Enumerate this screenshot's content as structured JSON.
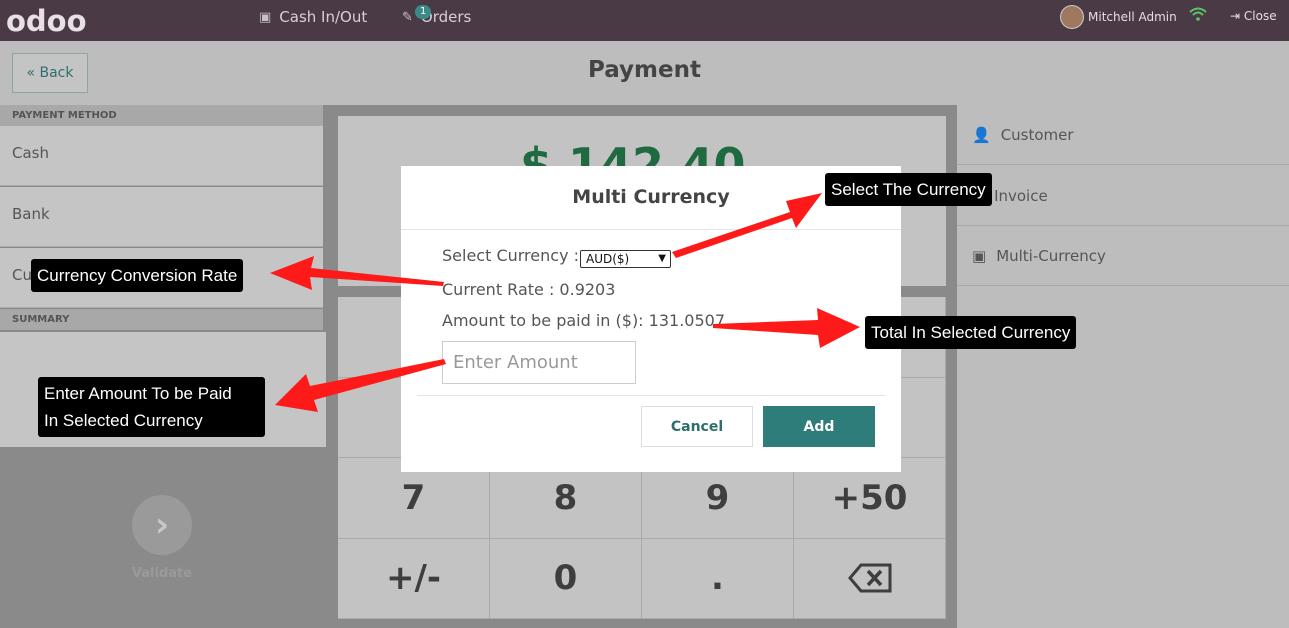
{
  "topbar": {
    "logo": "odoo",
    "cash_label": "Cash In/Out",
    "orders_label": "Orders",
    "orders_badge": "1",
    "user_name": "Mitchell Admin",
    "close_label": "Close"
  },
  "header": {
    "back_label": "Back",
    "title": "Payment"
  },
  "left": {
    "payment_method_header": "PAYMENT METHOD",
    "methods": [
      "Cash",
      "Bank",
      "Cu"
    ],
    "summary_header": "SUMMARY",
    "validate_label": "Validate"
  },
  "center": {
    "total": "$ 142.40",
    "keys": [
      "7",
      "8",
      "9",
      "+50",
      "+/-",
      "0",
      ".",
      "⌫"
    ]
  },
  "right": {
    "items": [
      "Customer",
      "Invoice",
      "Multi-Currency"
    ]
  },
  "modal": {
    "title": "Multi Currency",
    "select_label": "Select Currency :",
    "selected_currency": "AUD($)",
    "current_rate_label": "Current Rate : 0.9203",
    "amount_label": "Amount to be paid in ($):  131.0507",
    "amount_placeholder": "Enter Amount",
    "cancel_label": "Cancel",
    "add_label": "Add"
  },
  "annotations": {
    "select_currency": "Select The Currency",
    "conversion_rate": "Currency Conversion Rate",
    "total_selected": "Total In Selected Currency",
    "enter_amount_line1": "Enter Amount To be Paid",
    "enter_amount_line2": "In Selected Currency",
    "arrow_color": "#ff1a1a"
  }
}
